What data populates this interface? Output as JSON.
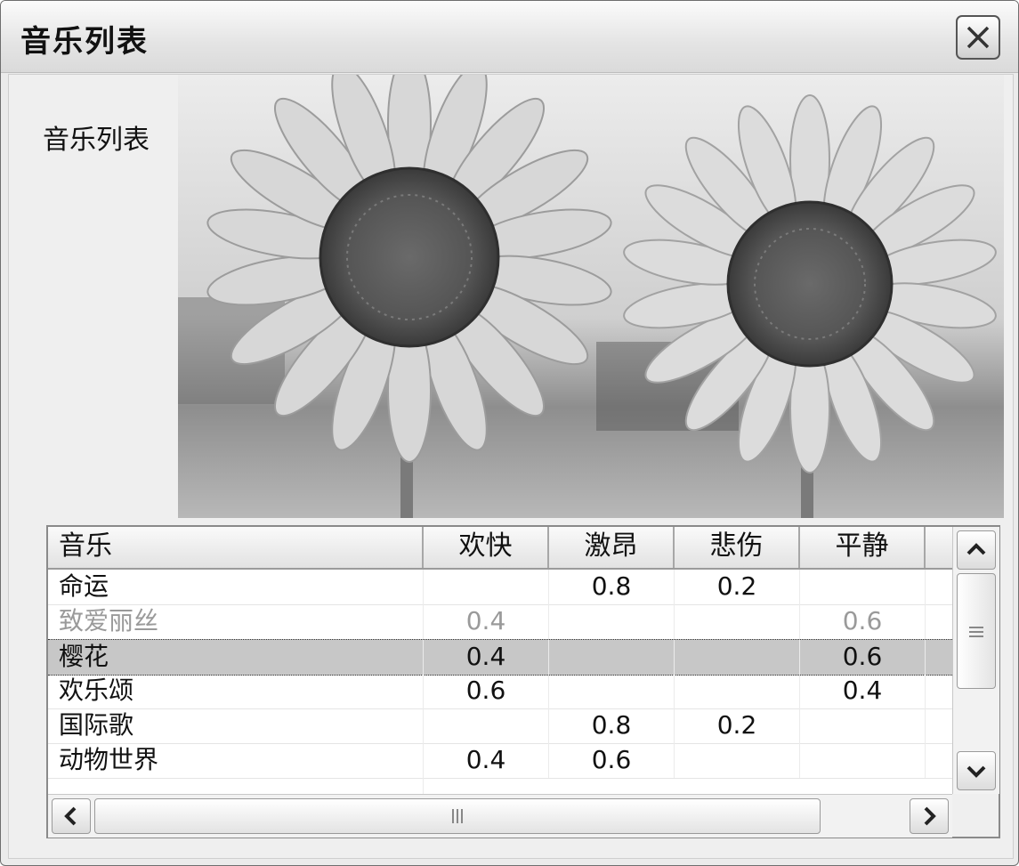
{
  "window": {
    "title": "音乐列表",
    "close_icon": "close-icon"
  },
  "side_label": "音乐列表",
  "image": {
    "subject": "sunflowers-photo"
  },
  "table": {
    "columns": [
      "音乐",
      "欢快",
      "激昂",
      "悲伤",
      "平静"
    ],
    "rows": [
      {
        "name": "命运",
        "c1": "",
        "c2": "0.8",
        "c3": "0.2",
        "c4": ""
      },
      {
        "name": "致爱丽丝",
        "c1": "0.4",
        "c2": "",
        "c3": "",
        "c4": "0.6"
      },
      {
        "name": "樱花",
        "c1": "0.4",
        "c2": "",
        "c3": "",
        "c4": "0.6"
      },
      {
        "name": "欢乐颂",
        "c1": "0.6",
        "c2": "",
        "c3": "",
        "c4": "0.4"
      },
      {
        "name": "国际歌",
        "c1": "",
        "c2": "0.8",
        "c3": "0.2",
        "c4": ""
      },
      {
        "name": "动物世界",
        "c1": "0.4",
        "c2": "0.6",
        "c3": "",
        "c4": ""
      },
      {
        "name": "",
        "c1": "",
        "c2": "",
        "c3": "",
        "c4": ""
      }
    ],
    "selected_row": 2
  },
  "colors": {
    "selection": "#c7c7c7",
    "window_bg": "#ebebeb"
  }
}
